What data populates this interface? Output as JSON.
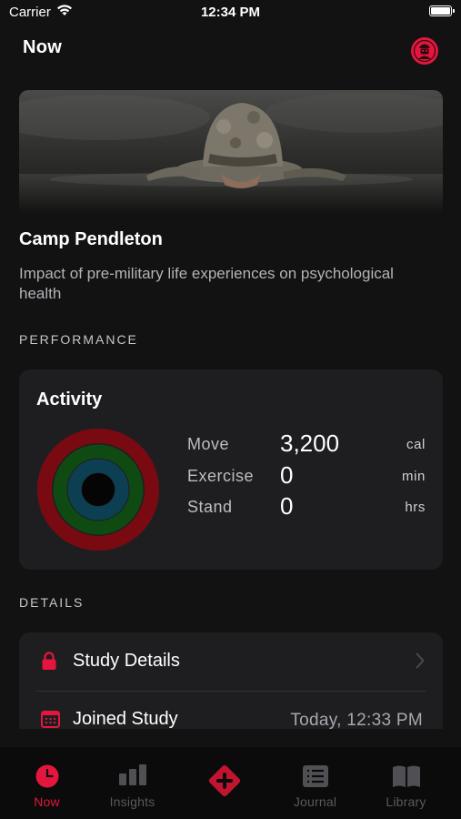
{
  "status_bar": {
    "carrier": "Carrier",
    "time": "12:34 PM"
  },
  "header": {
    "title": "Now"
  },
  "study": {
    "title": "Camp Pendleton",
    "description": "Impact of pre-military life experiences on psychological health"
  },
  "performance": {
    "section_label": "PERFORMANCE",
    "card_title": "Activity",
    "stats": [
      {
        "label": "Move",
        "value": "3,200",
        "unit": "cal"
      },
      {
        "label": "Exercise",
        "value": "0",
        "unit": "min"
      },
      {
        "label": "Stand",
        "value": "0",
        "unit": "hrs"
      }
    ],
    "ring_colors": {
      "move": "#7a0a12",
      "exercise": "#0f4a13",
      "stand": "#0d3f52"
    }
  },
  "details": {
    "section_label": "DETAILS",
    "rows": [
      {
        "label": "Study Details",
        "icon": "lock-icon"
      },
      {
        "label": "Joined Study",
        "value": "Today, 12:33 PM",
        "icon": "calendar-icon"
      }
    ]
  },
  "tabs": [
    {
      "label": "Now",
      "icon": "clock-icon",
      "active": true
    },
    {
      "label": "Insights",
      "icon": "bar-chart-icon"
    },
    {
      "label": "",
      "icon": "plus-diamond-icon"
    },
    {
      "label": "Journal",
      "icon": "journal-icon"
    },
    {
      "label": "Library",
      "icon": "book-icon"
    }
  ],
  "colors": {
    "accent": "#e4163d",
    "background": "#121213",
    "card": "#1e1e20"
  }
}
